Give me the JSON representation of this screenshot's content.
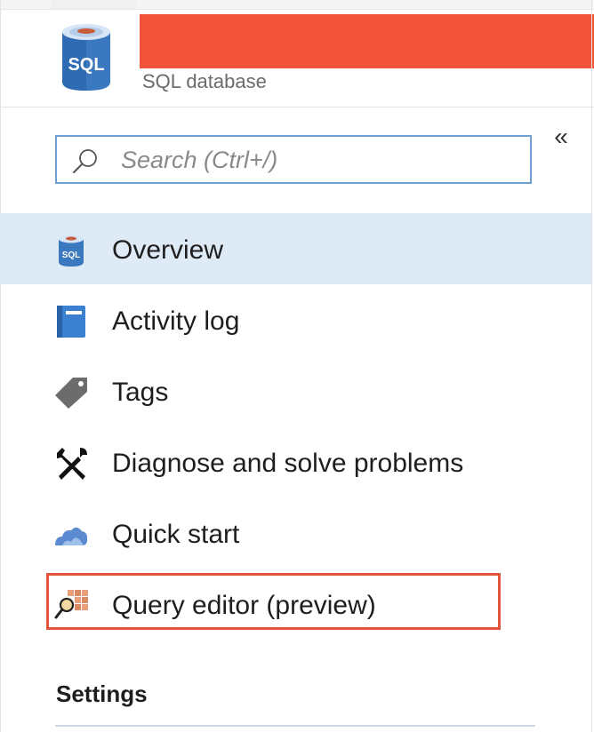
{
  "header": {
    "title_redacted": true,
    "subtitle": "SQL database",
    "icon": "sql-database-icon",
    "icon_text": "SQL"
  },
  "collapse": {
    "label": "«",
    "icon": "collapse-chevrons-icon"
  },
  "search": {
    "placeholder": "Search (Ctrl+/)",
    "value": "",
    "icon": "search-icon"
  },
  "nav": {
    "items": [
      {
        "label": "Overview",
        "icon": "sql-icon",
        "icon_text": "SQL",
        "selected": true
      },
      {
        "label": "Activity log",
        "icon": "book-icon",
        "selected": false
      },
      {
        "label": "Tags",
        "icon": "tag-icon",
        "selected": false
      },
      {
        "label": "Diagnose and solve problems",
        "icon": "wrench-screwdriver-icon",
        "selected": false
      },
      {
        "label": "Quick start",
        "icon": "cloud-icon",
        "selected": false
      },
      {
        "label": "Query editor (preview)",
        "icon": "query-editor-icon",
        "selected": false,
        "highlighted": true
      }
    ]
  },
  "sections": {
    "settings_title": "Settings"
  },
  "colors": {
    "accent_blue": "#3b7dc4",
    "selected_bg": "#dfeaf7",
    "highlight_red": "#e3543c",
    "redaction": "#f2533b",
    "search_border": "#6e9fd0"
  }
}
